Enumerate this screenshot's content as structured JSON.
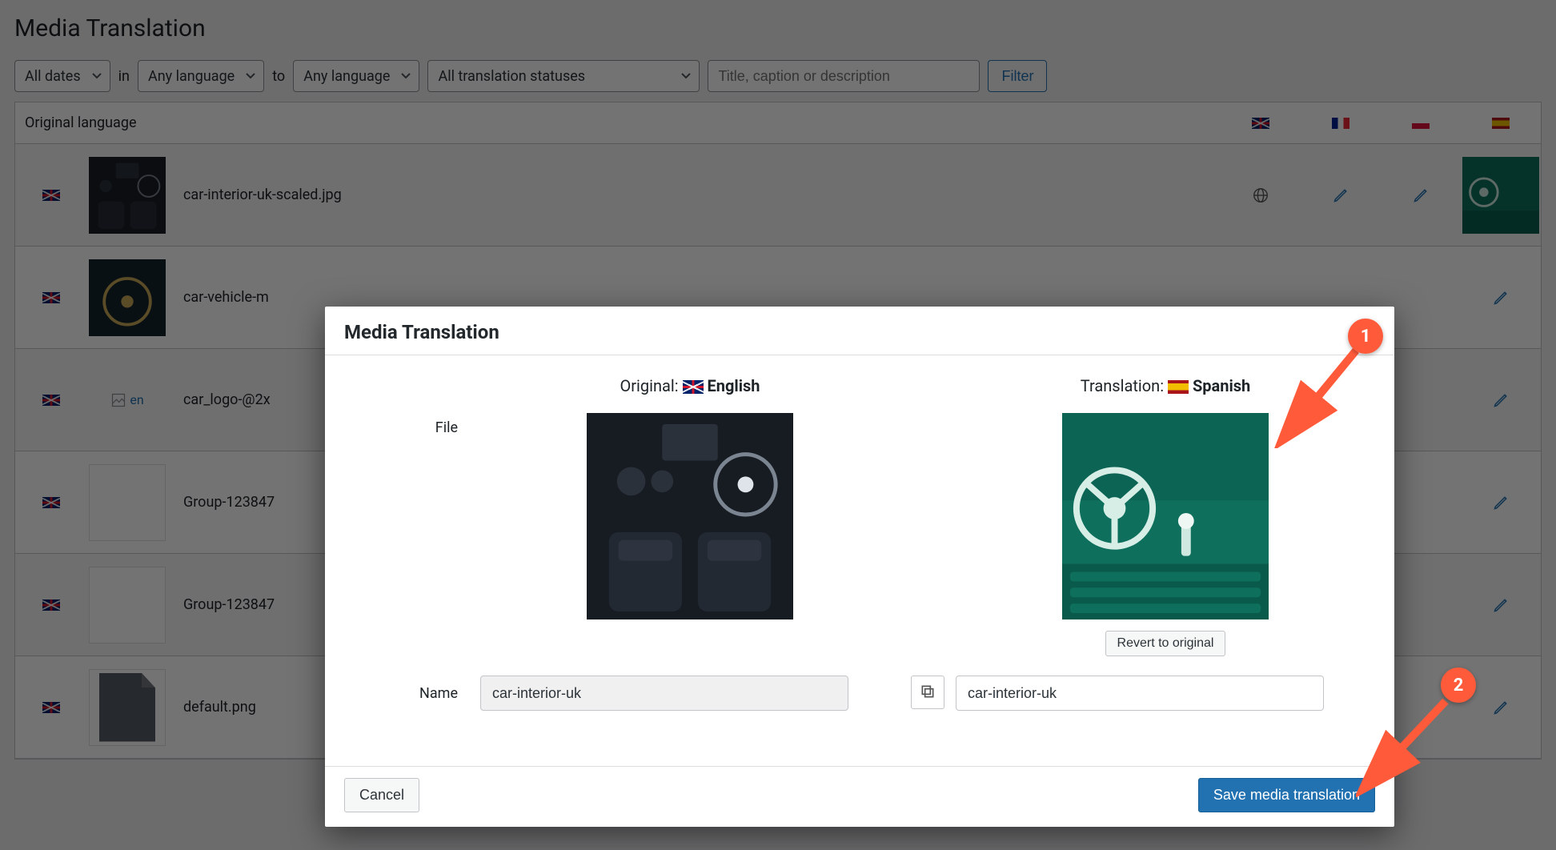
{
  "page": {
    "title": "Media Translation"
  },
  "filters": {
    "dates": "All dates",
    "in": "in",
    "lang_from": "Any language",
    "to": "to",
    "lang_to": "Any language",
    "status": "All translation statuses",
    "search_placeholder": "Title, caption or description",
    "filter_btn": "Filter"
  },
  "table": {
    "header_original": "Original language",
    "rows": [
      {
        "name": "car-interior-uk-scaled.jpg",
        "thumb": "car-dark",
        "statuses": [
          "globe",
          "pencil",
          "pencil",
          "thumb-trans"
        ]
      },
      {
        "name": "car-vehicle-m",
        "thumb": "wheel-vintage",
        "statuses": [
          "",
          "",
          "",
          "pencil"
        ]
      },
      {
        "name": "car_logo-@2x",
        "thumb": "broken",
        "broken_alt": "en",
        "statuses": [
          "",
          "",
          "",
          "pencil"
        ]
      },
      {
        "name": "Group-123847",
        "thumb": "white",
        "statuses": [
          "",
          "",
          "",
          "pencil"
        ]
      },
      {
        "name": "Group-123847",
        "thumb": "white",
        "statuses": [
          "",
          "",
          "",
          "pencil"
        ]
      },
      {
        "name": "default.png",
        "thumb": "doc",
        "statuses": [
          "",
          "",
          "",
          "pencil"
        ]
      }
    ]
  },
  "dialog": {
    "title": "Media Translation",
    "original_prefix": "Original: ",
    "original_lang": "English",
    "translation_prefix": "Translation: ",
    "translation_lang": "Spanish",
    "file_label": "File",
    "name_label": "Name",
    "name_original": "car-interior-uk",
    "name_translation": "car-interior-uk",
    "revert_btn": "Revert to original",
    "cancel_btn": "Cancel",
    "save_btn": "Save media translation"
  },
  "callouts": {
    "c1": "1",
    "c2": "2"
  }
}
